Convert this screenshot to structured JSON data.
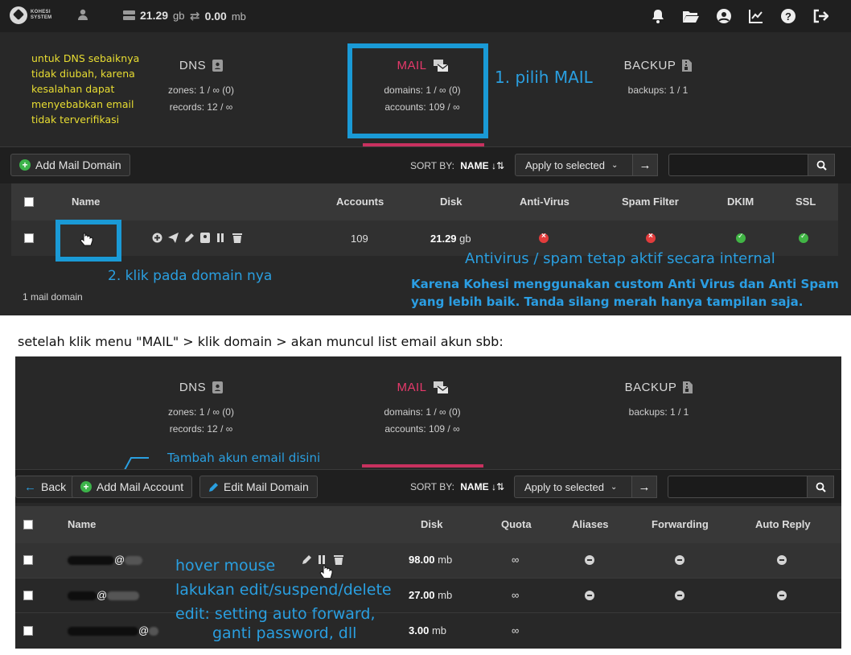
{
  "topbar": {
    "logo_text": "KOHESI SYSTEM",
    "disk": "21.29",
    "disk_unit": "gb",
    "bandwidth": "0.00",
    "bandwidth_unit": "mb",
    "right_icons": [
      "bell-icon",
      "folder-open-icon",
      "user-circle-icon",
      "chart-line-icon",
      "help-icon",
      "logout-icon"
    ]
  },
  "tabs": {
    "dns": {
      "title": "DNS",
      "stat1": "zones: 1 / ∞ (0)",
      "stat2": "records: 12 / ∞"
    },
    "mail": {
      "title": "MAIL",
      "stat1": "domains: 1 / ∞ (0)",
      "stat2": "accounts: 109 / ∞"
    },
    "backup": {
      "title": "BACKUP",
      "stat1": "backups: 1 / 1"
    }
  },
  "annotations": {
    "dns_note": "untuk DNS sebaiknya tidak diubah, karena kesalahan dapat menyebabkan email tidak terverifikasi",
    "step1": "1. pilih MAIL",
    "step2": "2. klik pada domain nya",
    "antivirus": "Antivirus / spam tetap aktif secara internal",
    "kohesi_note_line1": "Karena Kohesi menggunakan custom Anti Virus dan Anti Spam",
    "kohesi_note_line2": "yang lebih baik. Tanda silang merah hanya tampilan saja.",
    "caption": "setelah klik menu \"MAIL\" > klik domain > akan muncul list email akun sbb:",
    "add_account_hint": "Tambah akun email disini",
    "hover1": "hover mouse",
    "hover2": "lakukan edit/suspend/delete",
    "hover3": "edit: setting auto forward,",
    "hover4": "ganti password, dll"
  },
  "toolbar1": {
    "add_mail_domain": "Add Mail Domain",
    "sort_by": "SORT BY:",
    "sort_field": "NAME",
    "apply": "Apply to selected",
    "search_placeholder": ""
  },
  "domains_table": {
    "columns": [
      "Name",
      "Accounts",
      "Disk",
      "Anti-Virus",
      "Spam Filter",
      "DKIM",
      "SSL"
    ],
    "rows": [
      {
        "name": "",
        "accounts": "109",
        "disk": "21.29",
        "disk_unit": "gb",
        "antivirus": "off",
        "spam": "off",
        "dkim": "on",
        "ssl": "on"
      }
    ],
    "footer": "1 mail domain"
  },
  "toolbar2": {
    "back": "Back",
    "add_mail_account": "Add Mail Account",
    "edit_mail_domain": "Edit Mail Domain",
    "sort_by": "SORT BY:",
    "sort_field": "NAME",
    "apply": "Apply to selected"
  },
  "accounts_table": {
    "columns": [
      "Name",
      "Disk",
      "Quota",
      "Aliases",
      "Forwarding",
      "Auto Reply"
    ],
    "rows": [
      {
        "disk": "98.00",
        "disk_unit": "mb",
        "quota": "∞"
      },
      {
        "disk": "27.00",
        "disk_unit": "mb",
        "quota": "∞"
      },
      {
        "disk": "3.00",
        "disk_unit": "mb",
        "quota": "∞"
      }
    ]
  },
  "colors": {
    "accent": "#e6396b",
    "annotation": "#2a9fe0",
    "note": "#e8dd32",
    "ok": "#41b545",
    "error": "#e23c3c"
  }
}
